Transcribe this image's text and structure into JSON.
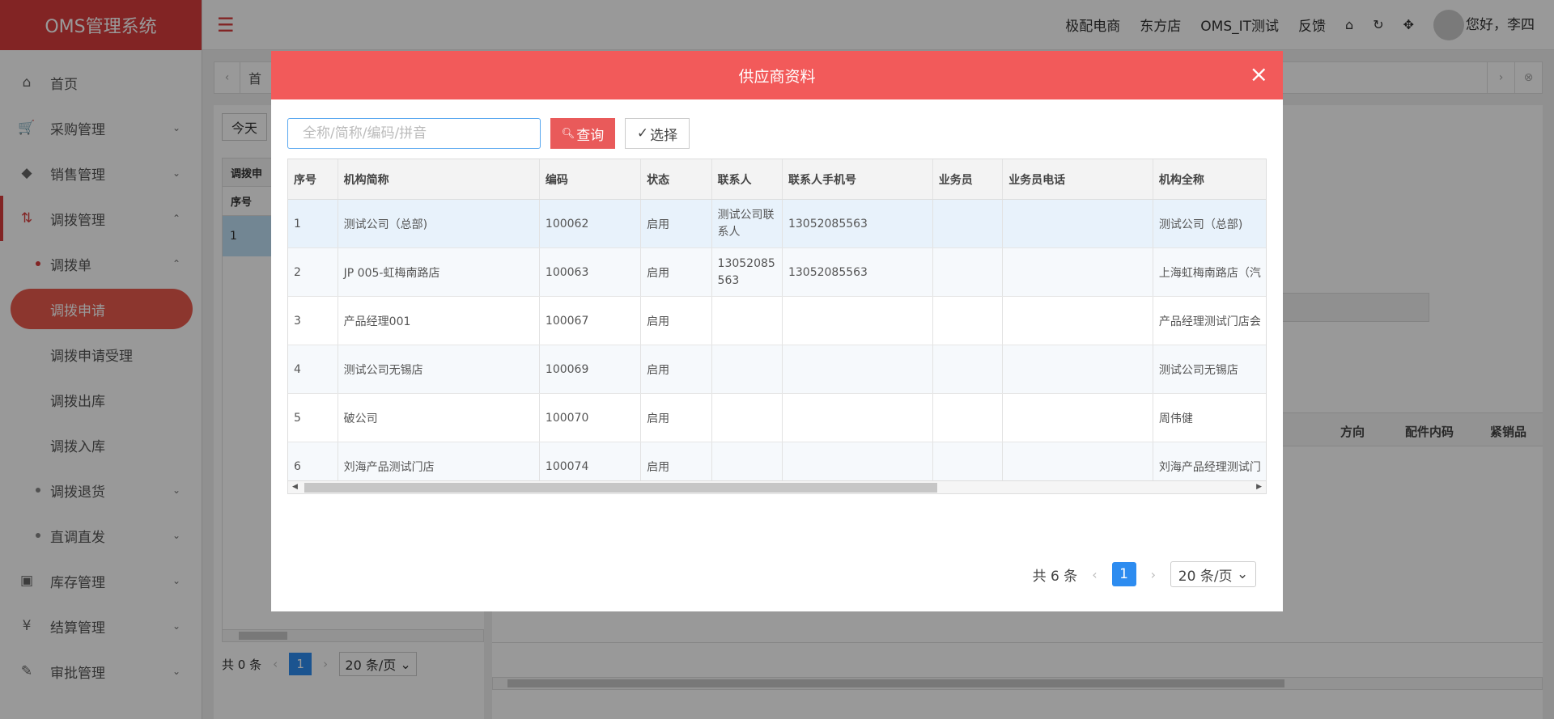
{
  "app": {
    "title": "OMS管理系统"
  },
  "topbar": {
    "links": [
      "极配电商",
      "东方店",
      "OMS_IT测试",
      "反馈"
    ],
    "greeting": "您好，李四"
  },
  "sidebar": {
    "items": [
      {
        "label": "首页",
        "icon": "home-icon"
      },
      {
        "label": "采购管理",
        "icon": "cart-icon"
      },
      {
        "label": "销售管理",
        "icon": "tag-icon"
      },
      {
        "label": "调拨管理",
        "icon": "transfer-icon"
      },
      {
        "label": "调拨单"
      },
      {
        "label": "调拨申请"
      },
      {
        "label": "调拨申请受理"
      },
      {
        "label": "调拨出库"
      },
      {
        "label": "调拨入库"
      },
      {
        "label": "调拨退货"
      },
      {
        "label": "直调直发"
      },
      {
        "label": "库存管理",
        "icon": "box-icon"
      },
      {
        "label": "结算管理",
        "icon": "yen-icon"
      },
      {
        "label": "审批管理",
        "icon": "pen-icon"
      }
    ]
  },
  "tabs": {
    "first": "首"
  },
  "left_panel": {
    "today": "今天",
    "header": "调拨申",
    "subheader": "序号",
    "row_num": "1",
    "footer_total": "共 0 条",
    "page": "1",
    "page_size": "20 条/页"
  },
  "right_panel": {
    "columns": [
      "方向",
      "配件内码",
      "紧销品"
    ]
  },
  "modal": {
    "title": "供应商资料",
    "search_placeholder": "全称/简称/编码/拼音",
    "query_label": "查询",
    "choose_label": "选择",
    "columns": [
      "序号",
      "机构简称",
      "编码",
      "状态",
      "联系人",
      "联系人手机号",
      "业务员",
      "业务员电话",
      "机构全称"
    ],
    "rows": [
      [
        "1",
        "测试公司（总部)",
        "100062",
        "启用",
        "测试公司联系人",
        "13052085563",
        "",
        "",
        "测试公司（总部)"
      ],
      [
        "2",
        "JP 005-虹梅南路店",
        "100063",
        "启用",
        "13052085563",
        "13052085563",
        "",
        "",
        "上海虹梅南路店（汽"
      ],
      [
        "3",
        "产品经理001",
        "100067",
        "启用",
        "",
        "",
        "",
        "",
        "产品经理测试门店会"
      ],
      [
        "4",
        "测试公司无锡店",
        "100069",
        "启用",
        "",
        "",
        "",
        "",
        "测试公司无锡店"
      ],
      [
        "5",
        "破公司",
        "100070",
        "启用",
        "",
        "",
        "",
        "",
        "周伟健"
      ],
      [
        "6",
        "刘海产品测试门店",
        "100074",
        "启用",
        "",
        "",
        "",
        "",
        "刘海产品经理测试门"
      ]
    ],
    "total": "共 6 条",
    "page": "1",
    "page_size": "20 条/页"
  },
  "colors": {
    "brand": "#d93c3c",
    "modal_header": "#f25a5a",
    "accent_blue": "#2d8cf0"
  }
}
